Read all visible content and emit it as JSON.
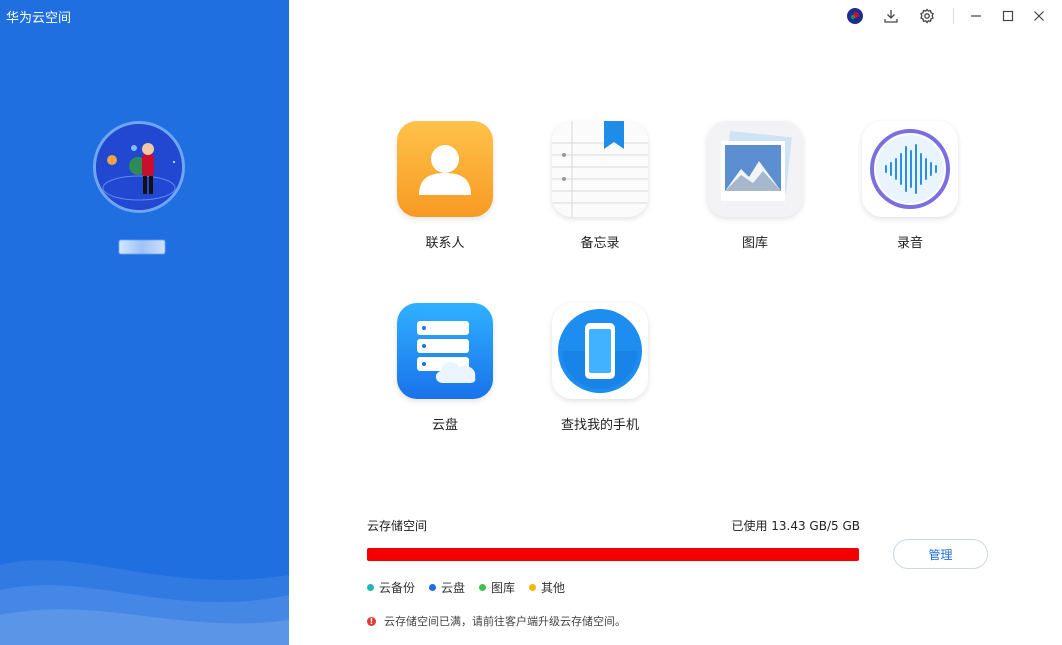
{
  "app": {
    "title": "华为云空间"
  },
  "user": {
    "name": "■■■■"
  },
  "window_controls": {
    "items": [
      "avatar-icon",
      "download-icon",
      "settings-icon",
      "minimize-icon",
      "maximize-icon",
      "close-icon"
    ]
  },
  "apps": [
    {
      "label": "联系人",
      "icon": "contacts-icon"
    },
    {
      "label": "备忘录",
      "icon": "notes-icon"
    },
    {
      "label": "图库",
      "icon": "gallery-icon"
    },
    {
      "label": "录音",
      "icon": "recorder-icon"
    },
    {
      "label": "云盘",
      "icon": "cloud-drive-icon"
    },
    {
      "label": "查找我的手机",
      "icon": "find-phone-icon"
    }
  ],
  "storage": {
    "title": "云存储空间",
    "used_text": "已使用 13.43 GB/5 GB",
    "usage_fraction": 1.0,
    "bar_color": "#f50000",
    "manage_label": "管理",
    "legend": [
      {
        "label": "云备份",
        "color": "#1fb8b0"
      },
      {
        "label": "云盘",
        "color": "#1f6fe0"
      },
      {
        "label": "图库",
        "color": "#43c04f"
      },
      {
        "label": "其他",
        "color": "#f5b800"
      }
    ],
    "warning": "云存储空间已满，请前往客户端升级云存储空间。"
  },
  "colors": {
    "accent": "#1f6fe0",
    "sidebar": "#1f6fe0"
  }
}
